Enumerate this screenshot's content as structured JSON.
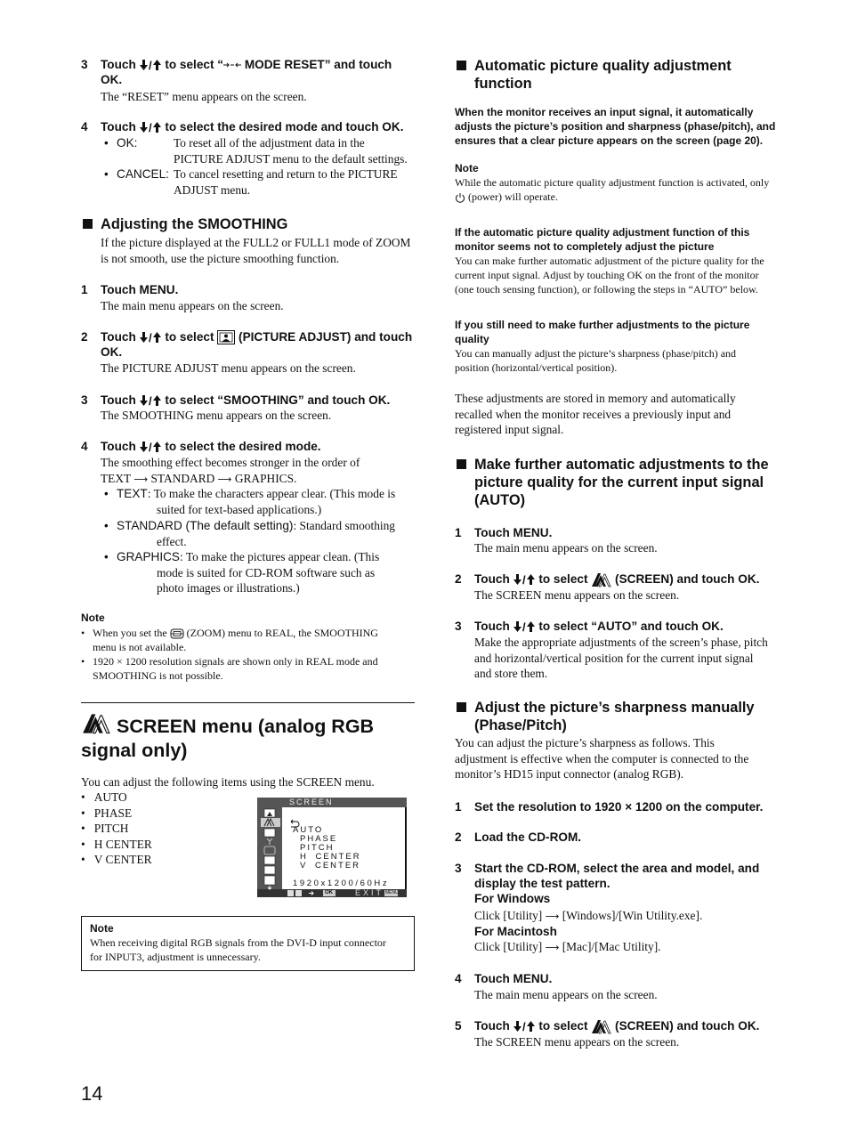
{
  "page_number": "14",
  "left": {
    "step3_reset": {
      "num": "3",
      "text_a": "Touch ",
      "text_b": " to select “",
      "text_c": " MODE RESET” and touch OK.",
      "body": "The “RESET” menu appears on the screen."
    },
    "step4_reset": {
      "num": "4",
      "text_a": "Touch ",
      "text_b": " to select the desired mode and touch OK.",
      "options": [
        {
          "label": "OK:",
          "desc": "To reset all of the adjustment data in the PICTURE ADJUST menu to the default settings."
        },
        {
          "label": "CANCEL:",
          "desc": "To cancel resetting and return to the PICTURE ADJUST menu."
        }
      ]
    },
    "smoothing": {
      "heading": "Adjusting the SMOOTHING",
      "intro": "If the picture displayed at the FULL2 or FULL1 mode of ZOOM is not smooth, use the picture smoothing function.",
      "steps": [
        {
          "num": "1",
          "title": "Touch MENU.",
          "body": "The main menu appears on the screen."
        },
        {
          "num": "2",
          "text_a": "Touch ",
          "text_b": " to select ",
          "text_c": " (PICTURE ADJUST) and touch OK.",
          "body": "The PICTURE ADJUST menu appears on the screen."
        },
        {
          "num": "3",
          "text_a": "Touch ",
          "text_b": " to select “SMOOTHING” and touch OK.",
          "body": "The SMOOTHING menu appears on the screen."
        },
        {
          "num": "4",
          "text_a": "Touch ",
          "text_b": " to select the desired mode.",
          "body1": "The smoothing effect becomes stronger in the order of",
          "order": [
            "TEXT",
            "STANDARD",
            "GRAPHICS."
          ]
        }
      ],
      "modes": [
        {
          "label": "TEXT",
          "desc_a": ": To make the characters appear clear. (This mode is",
          "desc_b": "suited for text-based applications.)"
        },
        {
          "label": "STANDARD (The default setting)",
          "desc_a": ": Standard smoothing",
          "desc_b": "effect."
        },
        {
          "label": "GRAPHICS",
          "desc_a": ": To make the pictures appear clean. (This",
          "desc_b": "mode is suited for CD-ROM software such as",
          "desc_c": "photo images or illustrations.)"
        }
      ],
      "note": {
        "title": "Note",
        "items": [
          {
            "a": "When you set the ",
            "b": " (ZOOM) menu to REAL, the SMOOTHING",
            "c": "menu is not available."
          },
          {
            "a": "1920 × 1200 resolution signals are shown only in REAL mode and",
            "c": "SMOOTHING is not possible."
          }
        ]
      }
    },
    "screen_menu": {
      "title_line1": "SCREEN menu (analog RGB",
      "title_line2": "signal only)",
      "intro": "You can adjust the following items using the SCREEN menu.",
      "items": [
        "AUTO",
        "PHASE",
        "PITCH",
        "H CENTER",
        "V CENTER"
      ],
      "osd": {
        "title": "SCREEN",
        "items": [
          "AUTO",
          "PHASE",
          "PITCH",
          "H CENTER",
          "V CENTER"
        ],
        "resolution": "1920x1200/60Hz",
        "footer_ok": "OK",
        "footer_exit": "EXIT",
        "footer_menu": "MENU"
      },
      "note": {
        "title": "Note",
        "body_a": "When receiving digital RGB signals from the DVI-D input connector",
        "body_b": "for INPUT3, adjustment is unnecessary."
      }
    }
  },
  "right": {
    "auto_func": {
      "heading_a": "Automatic picture quality adjustment",
      "heading_b": "function",
      "bold_intro": [
        "When the monitor receives an input signal, it automatically",
        "adjusts the picture’s position and sharpness (phase/pitch), and",
        "ensures that a clear picture appears on the screen (page 20)."
      ],
      "note_title": "Note",
      "note_a": "While the automatic picture quality adjustment function is activated, only",
      "note_b": " (power) will operate.",
      "sub1_title": [
        "If the automatic picture quality adjustment function of this",
        "monitor seems not to completely adjust the picture"
      ],
      "sub1_body": [
        "You can make further automatic adjustment of the picture quality for the",
        "current input signal. Adjust by touching OK on the front of the monitor",
        "(one touch sensing function), or following the steps in “AUTO” below."
      ],
      "sub2_title": [
        "If you still need to make further adjustments to the picture",
        "quality"
      ],
      "sub2_body": [
        "You can manually adjust the picture’s sharpness (phase/pitch) and",
        "position (horizontal/vertical position)."
      ],
      "stored": [
        "These adjustments are stored in memory and automatically",
        "recalled when the monitor receives a previously input and",
        "registered input signal."
      ]
    },
    "auto_section": {
      "heading": [
        "Make further automatic adjustments to the",
        "picture quality for the current input signal",
        "(AUTO)"
      ],
      "steps": [
        {
          "num": "1",
          "title": "Touch MENU.",
          "body": "The main menu appears on the screen."
        },
        {
          "num": "2",
          "text_a": "Touch ",
          "text_b": " to select ",
          "text_c": " (SCREEN) and touch OK.",
          "body": "The SCREEN menu appears on the screen."
        },
        {
          "num": "3",
          "text_a": "Touch ",
          "text_b": " to select “AUTO” and touch OK.",
          "body": [
            "Make the appropriate adjustments of the screen’s phase, pitch",
            "and horizontal/vertical position for the current input signal",
            "and store them."
          ]
        }
      ]
    },
    "manual_section": {
      "heading": [
        "Adjust the picture’s sharpness manually",
        "(Phase/Pitch)"
      ],
      "intro": [
        "You can adjust the picture’s sharpness as follows. This",
        "adjustment is effective when the computer is connected to the",
        "monitor’s HD15 input connector (analog RGB)."
      ],
      "steps": [
        {
          "num": "1",
          "title": "Set the resolution to 1920 × 1200 on the computer."
        },
        {
          "num": "2",
          "title": "Load the CD-ROM."
        },
        {
          "num": "3",
          "title": [
            "Start the CD-ROM, select the area and model, and",
            "display the test pattern."
          ],
          "win_label": "For Windows",
          "win_a": "Click [Utility] ",
          "win_b": " [Windows]/[Win Utility.exe].",
          "mac_label": "For Macintosh",
          "mac_a": "Click [Utility] ",
          "mac_b": " [Mac]/[Mac Utility]."
        },
        {
          "num": "4",
          "title": "Touch MENU.",
          "body": "The main menu appears on the screen."
        },
        {
          "num": "5",
          "text_a": "Touch ",
          "text_b": " to select ",
          "text_c": " (SCREEN) and touch OK.",
          "body": "The SCREEN menu appears on the screen."
        }
      ]
    }
  }
}
